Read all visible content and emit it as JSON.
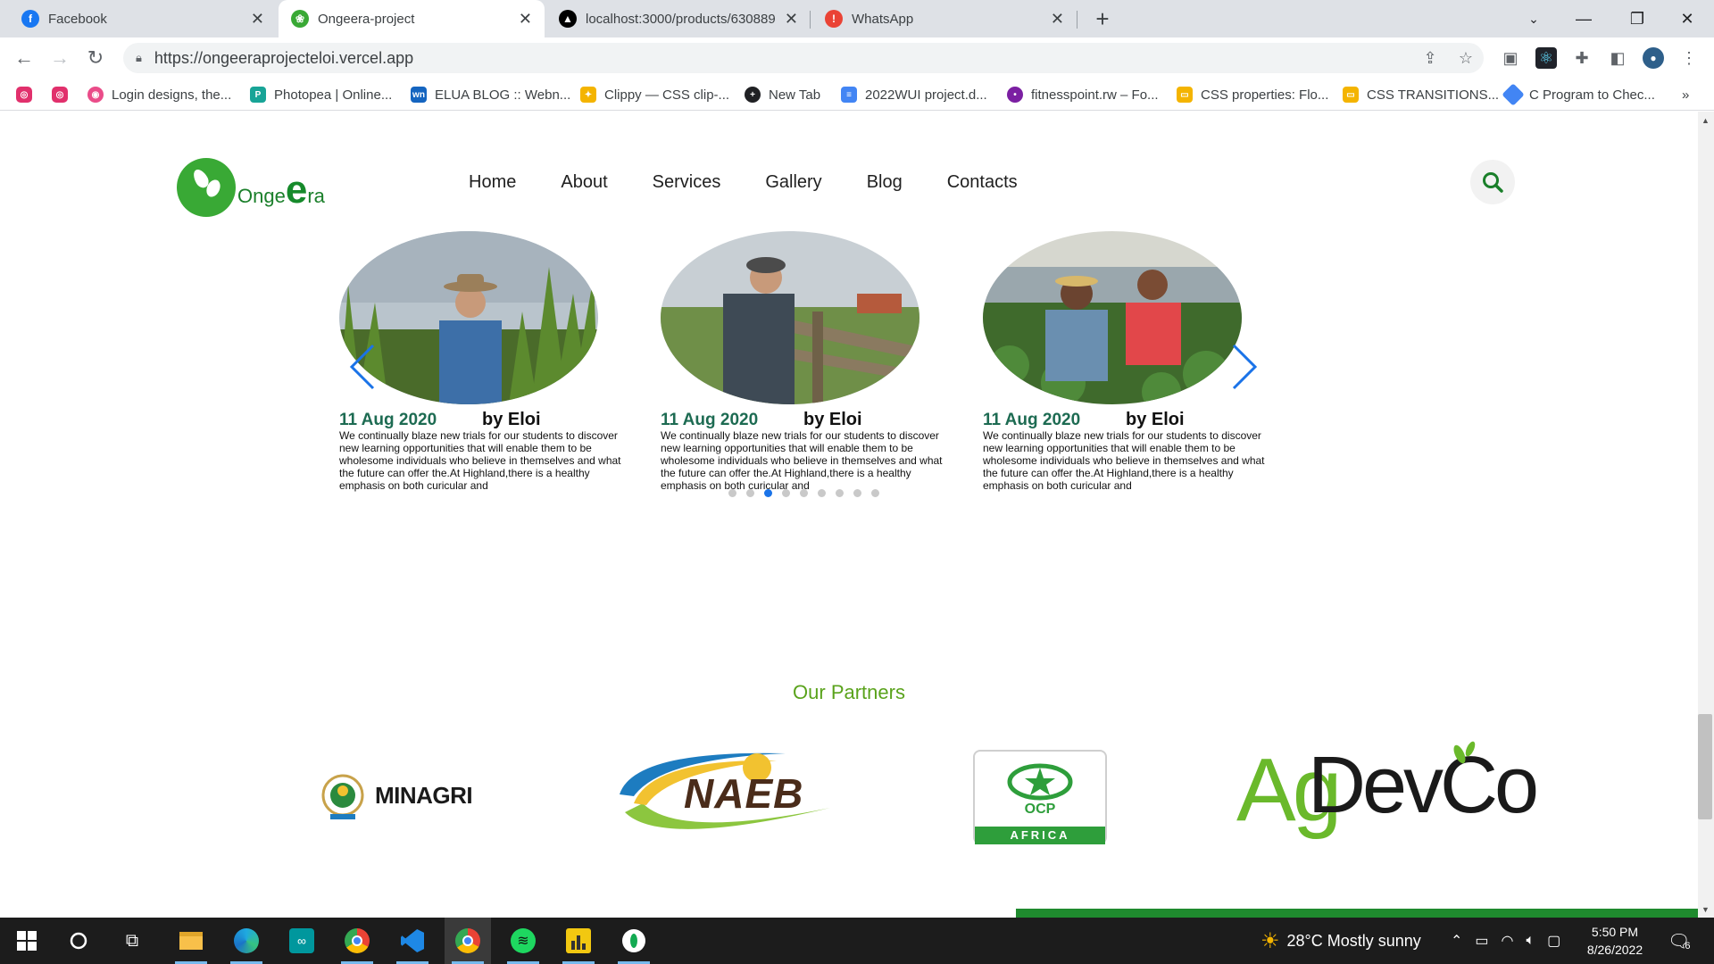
{
  "browser": {
    "tabs": [
      {
        "title": "Facebook",
        "icon": "facebook-icon",
        "color": "#1877f2"
      },
      {
        "title": "Ongeera-project",
        "icon": "leaf-icon",
        "color": "#39a935"
      },
      {
        "title": "localhost:3000/products/630889",
        "icon": "triangle-icon",
        "color": "#000000"
      },
      {
        "title": "WhatsApp",
        "icon": "alert-icon",
        "color": "#ea4335"
      }
    ],
    "url": "https://ongeeraprojecteloi.vercel.app",
    "bookmarks": [
      {
        "label": "",
        "icon": "instagram-icon",
        "color": "#e1306c"
      },
      {
        "label": "",
        "icon": "instagram-icon",
        "color": "#e1306c"
      },
      {
        "label": "Login designs, the...",
        "icon": "dribbble-icon",
        "color": "#ea4c89"
      },
      {
        "label": "Photopea | Online...",
        "icon": "photopea-icon",
        "color": "#18a497"
      },
      {
        "label": "ELUA BLOG :: Webn...",
        "icon": "wn-icon",
        "color": "#1565c0"
      },
      {
        "label": "Clippy — CSS clip-...",
        "icon": "clippy-icon",
        "color": "#f4b400"
      },
      {
        "label": "New Tab",
        "icon": "plus-circle-icon",
        "color": "#202124"
      },
      {
        "label": "2022WUI project.d...",
        "icon": "docs-icon",
        "color": "#4285f4"
      },
      {
        "label": "fitnesspoint.rw – Fo...",
        "icon": "fitness-icon",
        "color": "#7b1fa2"
      },
      {
        "label": "CSS properties: Flo...",
        "icon": "slides-icon",
        "color": "#f4b400"
      },
      {
        "label": "CSS TRANSITIONS...",
        "icon": "slides-icon",
        "color": "#f4b400"
      },
      {
        "label": "C Program to Chec...",
        "icon": "diamond-icon",
        "color": "#4285f4"
      }
    ],
    "more_bookmarks": "»"
  },
  "site": {
    "logo": {
      "prefix": "Onge",
      "big": "e",
      "suffix": "ra"
    },
    "nav": [
      "Home",
      "About",
      "Services",
      "Gallery",
      "Blog",
      "Contacts"
    ],
    "accent": "#39a935",
    "posts": [
      {
        "date": "11 Aug 2020",
        "author": "by Eloi",
        "text": "We continually blaze new trials for our students to discover new learning opportunities that will enable them to be wholesome individuals who believe in themselves and what the future can offer the.At Highland,there is a healthy emphasis on both curicular and"
      },
      {
        "date": "11 Aug 2020",
        "author": "by Eloi",
        "text": "We continually blaze new trials for our students to discover new learning opportunities that will enable them to be wholesome individuals who believe in themselves and what the future can offer the.At Highland,there is a healthy emphasis on both curicular and"
      },
      {
        "date": "11 Aug 2020",
        "author": "by Eloi",
        "text": "We continually blaze new trials for our students to discover new learning opportunities that will enable them to be wholesome individuals who believe in themselves and what the future can offer the.At Highland,there is a healthy emphasis on both curicular and"
      }
    ],
    "carousel": {
      "dot_count": 9,
      "active_index": 2
    },
    "partners_title": "Our Partners",
    "partners": {
      "minagri": "MINAGRI",
      "naeb": "NAEB",
      "ocp_top": "OCP",
      "ocp_bottom": "AFRICA",
      "agdevco_ag": "Ag",
      "agdevco_rest": "DevCo"
    }
  },
  "taskbar": {
    "weather": "28°C  Mostly sunny",
    "time": "5:50 PM",
    "date": "8/26/2022",
    "notifications": "6"
  }
}
